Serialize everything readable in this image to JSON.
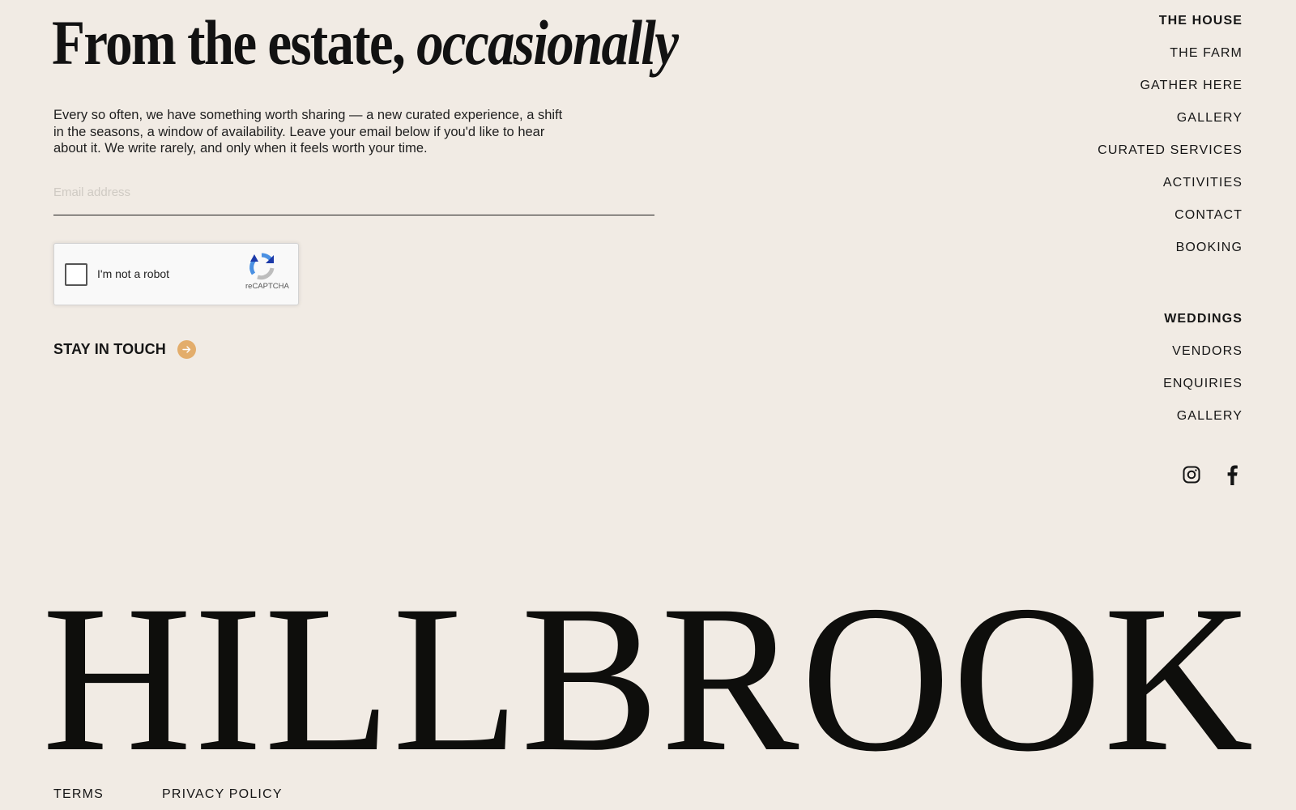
{
  "newsletter": {
    "headline_regular": "From the estate,",
    "headline_italic": "occasionally",
    "intro": "Every so often, we have something worth sharing — a new curated experience, a shift in the seasons, a window of availability. Leave your email below if you'd like to hear about it. We write rarely, and only when it feels worth your time.",
    "email_placeholder": "Email address",
    "email_value": "",
    "recaptcha_label": "I'm not a robot",
    "recaptcha_brand": "reCAPTCHA",
    "recaptcha_checked": false,
    "cta_label": "STAY IN TOUCH",
    "cta_icon": "arrow-right-icon",
    "accent_color": "#e3ad6b"
  },
  "nav": {
    "house": [
      {
        "label": "THE HOUSE",
        "strong": true
      },
      {
        "label": "THE FARM",
        "strong": false
      },
      {
        "label": "GATHER HERE",
        "strong": false
      },
      {
        "label": "GALLERY",
        "strong": false
      },
      {
        "label": "CURATED SERVICES",
        "strong": false
      },
      {
        "label": "ACTIVITIES",
        "strong": false
      },
      {
        "label": "CONTACT",
        "strong": false
      },
      {
        "label": "BOOKING",
        "strong": false
      }
    ],
    "weddings": [
      {
        "label": "WEDDINGS",
        "strong": true
      },
      {
        "label": "VENDORS",
        "strong": false
      },
      {
        "label": "ENQUIRIES",
        "strong": false
      },
      {
        "label": "GALLERY",
        "strong": false
      }
    ]
  },
  "social": {
    "icons": [
      "instagram-icon",
      "facebook-icon"
    ]
  },
  "brand": {
    "wordmark": "HILLBROOK"
  },
  "legal": {
    "terms": "TERMS",
    "privacy": "PRIVACY POLICY"
  },
  "colors": {
    "background": "#f1ebe4",
    "text": "#141414"
  }
}
